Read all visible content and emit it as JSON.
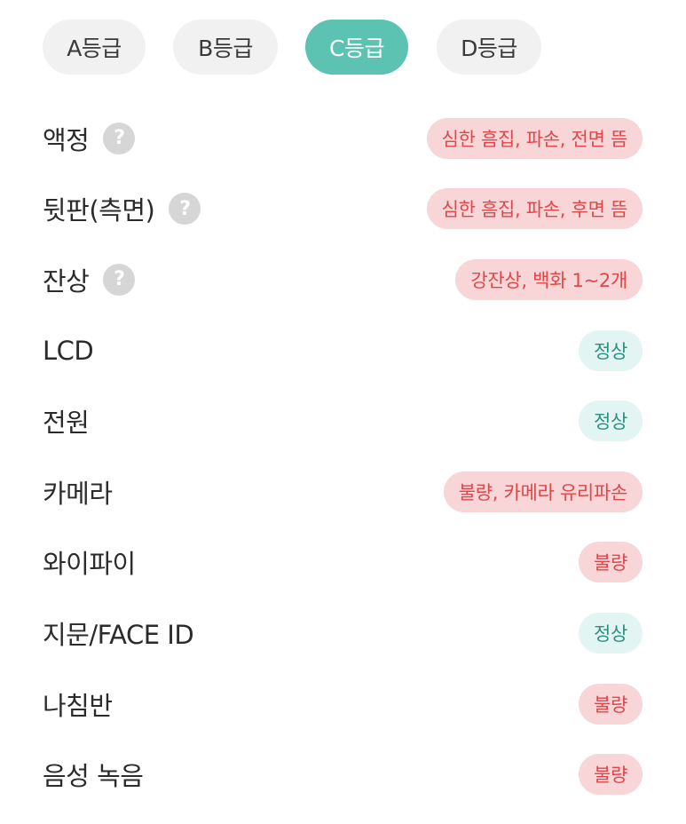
{
  "grade_tabs": [
    {
      "label": "A등급",
      "active": false
    },
    {
      "label": "B등급",
      "active": false
    },
    {
      "label": "C등급",
      "active": true
    },
    {
      "label": "D등급",
      "active": false
    }
  ],
  "help_icon_glyph": "?",
  "rows": [
    {
      "label": "액정",
      "has_help": true,
      "status": "심한 흠집, 파손, 전면 뜸",
      "status_type": "bad"
    },
    {
      "label": "뒷판(측면)",
      "has_help": true,
      "status": "심한 흠집, 파손, 후면 뜸",
      "status_type": "bad"
    },
    {
      "label": "잔상",
      "has_help": true,
      "status": "강잔상, 백화 1~2개",
      "status_type": "bad"
    },
    {
      "label": "LCD",
      "has_help": false,
      "status": "정상",
      "status_type": "good"
    },
    {
      "label": "전원",
      "has_help": false,
      "status": "정상",
      "status_type": "good"
    },
    {
      "label": "카메라",
      "has_help": false,
      "status": "불량, 카메라 유리파손",
      "status_type": "bad"
    },
    {
      "label": "와이파이",
      "has_help": false,
      "status": "불량",
      "status_type": "bad"
    },
    {
      "label": "지문/FACE ID",
      "has_help": false,
      "status": "정상",
      "status_type": "good"
    },
    {
      "label": "나침반",
      "has_help": false,
      "status": "불량",
      "status_type": "bad"
    },
    {
      "label": "음성 녹음",
      "has_help": false,
      "status": "불량",
      "status_type": "bad"
    }
  ],
  "colors": {
    "accent": "#5cc2b2",
    "bad_bg": "#f8d5d6",
    "bad_text": "#e0474b",
    "good_bg": "#e2f5f2",
    "good_text": "#2d8f7e"
  }
}
